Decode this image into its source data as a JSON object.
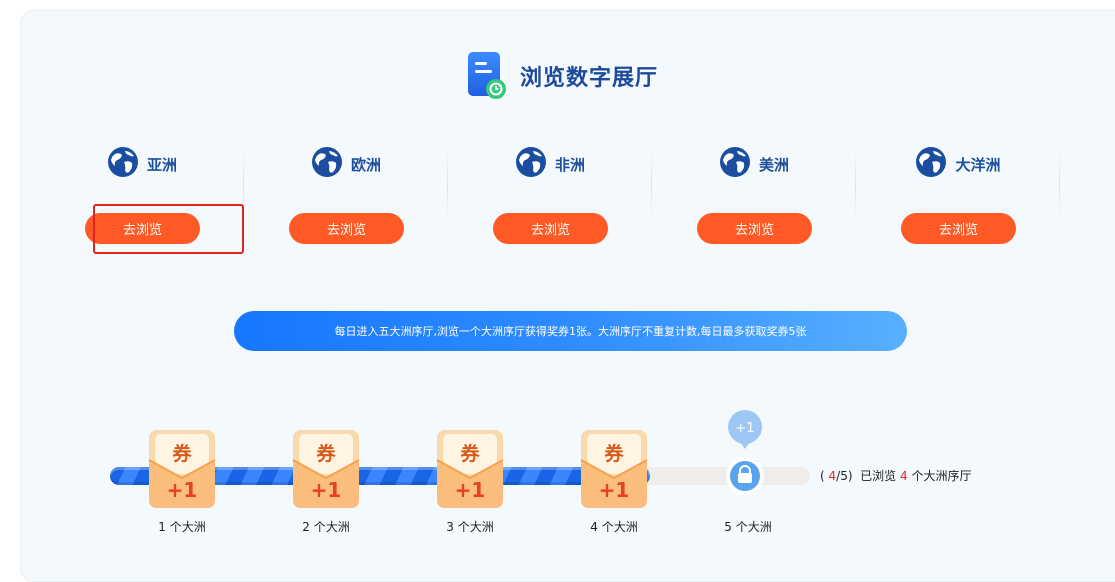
{
  "header": {
    "title": "浏览数字展厅",
    "icon": "document-clock-icon"
  },
  "continents": [
    {
      "name": "亚洲",
      "button": "去浏览"
    },
    {
      "name": "欧洲",
      "button": "去浏览"
    },
    {
      "name": "非洲",
      "button": "去浏览"
    },
    {
      "name": "美洲",
      "button": "去浏览"
    },
    {
      "name": "大洋洲",
      "button": "去浏览"
    }
  ],
  "notice": "每日进入五大洲序厅,浏览一个大洲序厅获得奖券1张。大洲序厅不重复计数,每日最多获取奖券5张",
  "progress": {
    "current": 4,
    "total": 5,
    "steps": [
      {
        "label": "1 个大洲",
        "coupon": "券",
        "reward": "+1"
      },
      {
        "label": "2 个大洲",
        "coupon": "券",
        "reward": "+1"
      },
      {
        "label": "3 个大洲",
        "coupon": "券",
        "reward": "+1"
      },
      {
        "label": "4 个大洲",
        "coupon": "券",
        "reward": "+1"
      },
      {
        "label": "5 个大洲",
        "reward": "+1"
      }
    ],
    "text_open": "(",
    "text_mid": "/5)",
    "text_prefix": "已浏览",
    "text_suffix": "个大洲序厅"
  },
  "colors": {
    "accent": "#ff5a26",
    "brand_blue": "#1677ff",
    "title_blue": "#1d4a9c",
    "count_red": "#e5292e"
  }
}
